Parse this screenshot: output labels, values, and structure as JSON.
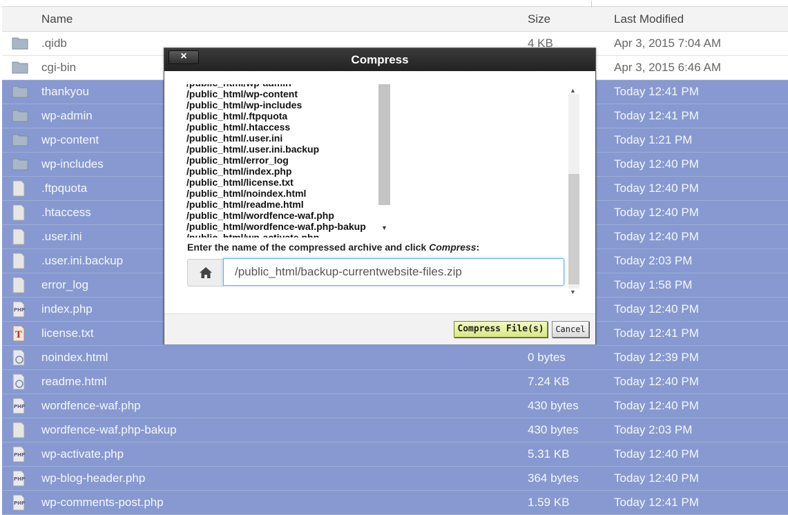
{
  "table": {
    "headers": {
      "name": "Name",
      "size": "Size",
      "modified": "Last Modified"
    },
    "rows": [
      {
        "icon": "folder-icon",
        "name": ".qidb",
        "size": "4 KB",
        "modified": "Apr 3, 2015 7:04 AM",
        "selected": false
      },
      {
        "icon": "folder-icon",
        "name": "cgi-bin",
        "size": "",
        "modified": "Apr 3, 2015 6:46 AM",
        "selected": false
      },
      {
        "icon": "folder-icon",
        "name": "thankyou",
        "size": "",
        "modified": "Today 12:41 PM",
        "selected": true
      },
      {
        "icon": "folder-icon",
        "name": "wp-admin",
        "size": "",
        "modified": "Today 12:41 PM",
        "selected": true
      },
      {
        "icon": "folder-icon",
        "name": "wp-content",
        "size": "",
        "modified": "Today 1:21 PM",
        "selected": true
      },
      {
        "icon": "folder-icon",
        "name": "wp-includes",
        "size": "",
        "modified": "Today 12:40 PM",
        "selected": true
      },
      {
        "icon": "file-icon",
        "name": ".ftpquota",
        "size": "",
        "modified": "Today 12:40 PM",
        "selected": true
      },
      {
        "icon": "file-icon",
        "name": ".htaccess",
        "size": "",
        "modified": "Today 12:40 PM",
        "selected": true
      },
      {
        "icon": "file-icon",
        "name": ".user.ini",
        "size": "",
        "modified": "Today 12:40 PM",
        "selected": true
      },
      {
        "icon": "file-icon",
        "name": ".user.ini.backup",
        "size": "",
        "modified": "Today 2:03 PM",
        "selected": true
      },
      {
        "icon": "file-icon",
        "name": "error_log",
        "size": "",
        "modified": "Today 1:58 PM",
        "selected": true
      },
      {
        "icon": "php-file-icon",
        "name": "index.php",
        "size": "",
        "modified": "Today 12:40 PM",
        "selected": true
      },
      {
        "icon": "text-file-icon",
        "name": "license.txt",
        "size": "",
        "modified": "Today 12:41 PM",
        "selected": true
      },
      {
        "icon": "html-file-icon",
        "name": "noindex.html",
        "size": "0 bytes",
        "modified": "Today 12:39 PM",
        "selected": true
      },
      {
        "icon": "html-file-icon",
        "name": "readme.html",
        "size": "7.24 KB",
        "modified": "Today 12:40 PM",
        "selected": true
      },
      {
        "icon": "php-file-icon",
        "name": "wordfence-waf.php",
        "size": "430 bytes",
        "modified": "Today 12:40 PM",
        "selected": true
      },
      {
        "icon": "file-icon",
        "name": "wordfence-waf.php-bakup",
        "size": "430 bytes",
        "modified": "Today 2:03 PM",
        "selected": true
      },
      {
        "icon": "php-file-icon",
        "name": "wp-activate.php",
        "size": "5.31 KB",
        "modified": "Today 12:40 PM",
        "selected": true
      },
      {
        "icon": "php-file-icon",
        "name": "wp-blog-header.php",
        "size": "364 bytes",
        "modified": "Today 12:40 PM",
        "selected": true
      },
      {
        "icon": "php-file-icon",
        "name": "wp-comments-post.php",
        "size": "1.59 KB",
        "modified": "Today 12:41 PM",
        "selected": true
      }
    ]
  },
  "dialog": {
    "title": "Compress",
    "close_label": "×",
    "file_list": [
      "/public_html/wp-admin",
      "/public_html/wp-content",
      "/public_html/wp-includes",
      "/public_html/.ftpquota",
      "/public_html/.htaccess",
      "/public_html/.user.ini",
      "/public_html/.user.ini.backup",
      "/public_html/error_log",
      "/public_html/index.php",
      "/public_html/license.txt",
      "/public_html/noindex.html",
      "/public_html/readme.html",
      "/public_html/wordfence-waf.php",
      "/public_html/wordfence-waf.php-bakup",
      "/public_html/wp-activate.php"
    ],
    "prompt_text": "Enter the name of the compressed archive and click ",
    "prompt_emph": "Compress",
    "prompt_end": ":",
    "archive_name": "/public_html/backup-currentwebsite-files.zip",
    "compress_button": "Compress File(s)",
    "cancel_button": "Cancel"
  },
  "colors": {
    "selected_row": "#8799d0",
    "dialog_title_bar": "#2b2b2b",
    "compress_button": "#e3ef9c"
  }
}
